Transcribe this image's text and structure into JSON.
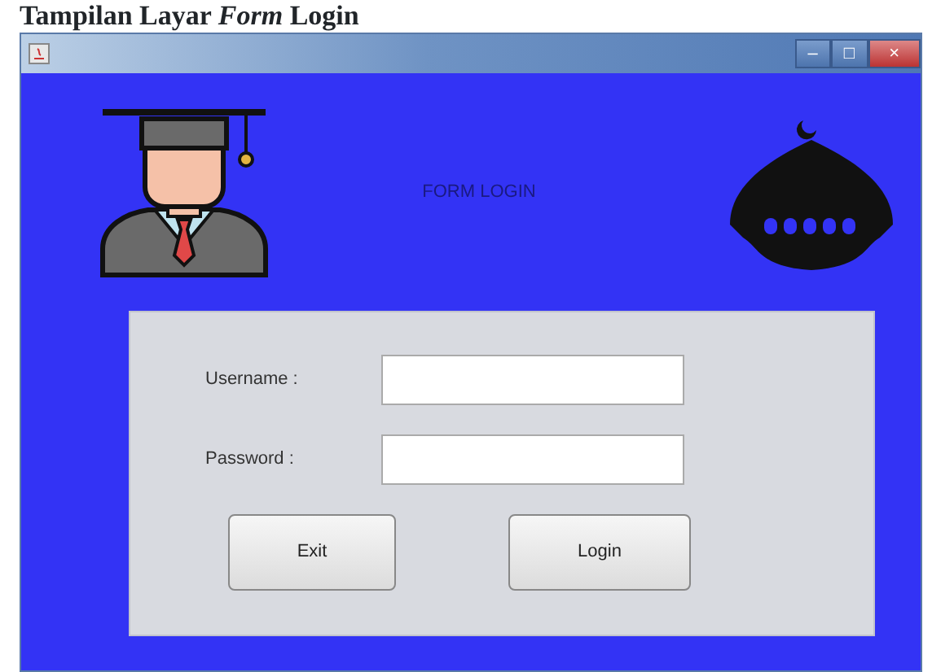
{
  "caption": "Tampilan Layar *Form* Login",
  "window": {
    "controls": [
      "–",
      "□",
      "×"
    ]
  },
  "header": {
    "title": "FORM LOGIN"
  },
  "fields": [
    {
      "label": "Username :"
    },
    {
      "label": "Password :"
    }
  ],
  "buttons": [
    "Exit",
    "Login"
  ]
}
